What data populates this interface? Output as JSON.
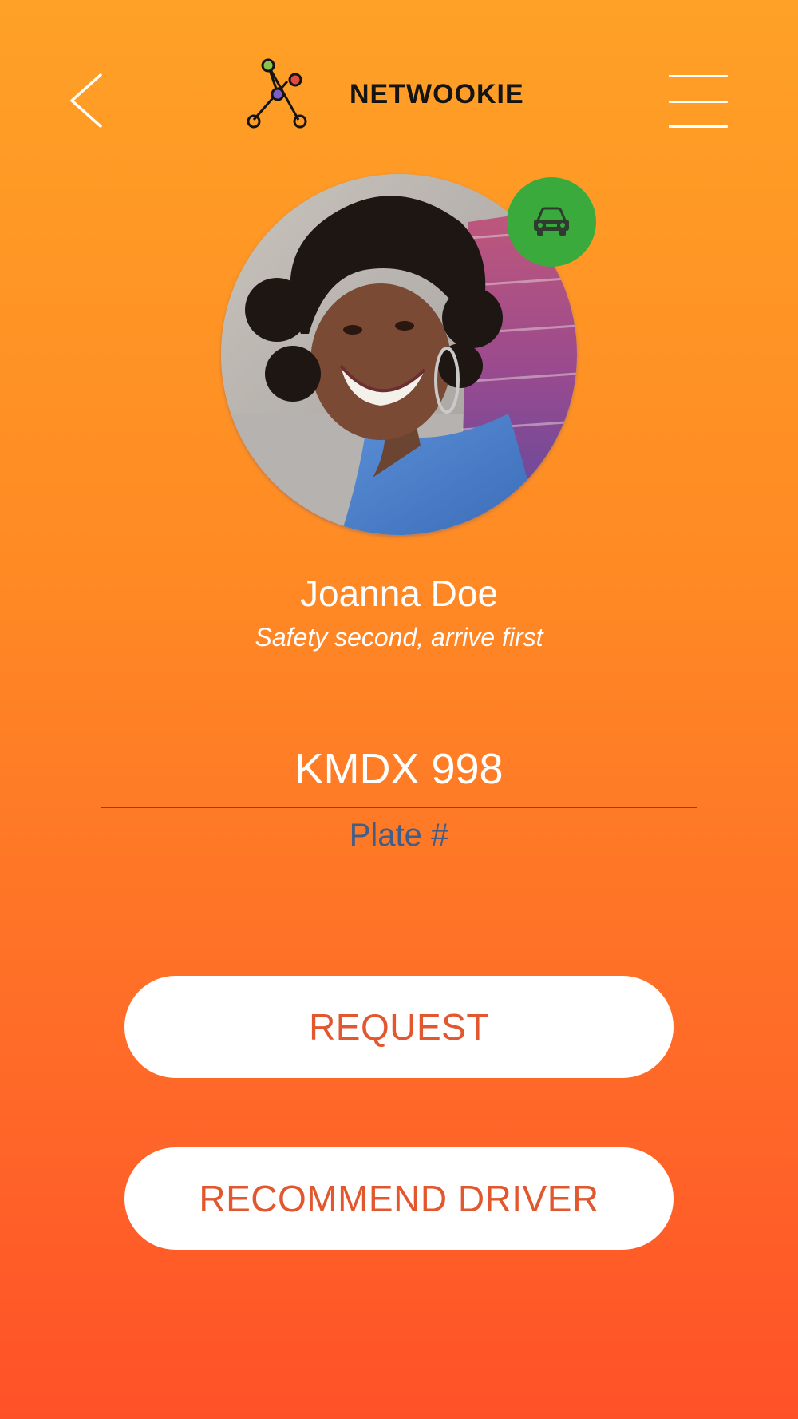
{
  "header": {
    "back_icon": "chevron-left-icon",
    "logo_icon": "network-nodes-icon",
    "brand_name": "NETWOOKIE",
    "menu_icon": "hamburger-menu-icon"
  },
  "profile": {
    "avatar": "profile-photo",
    "badge_icon": "car-icon",
    "name": "Joanna Doe",
    "tagline": "Safety second, arrive first"
  },
  "plate": {
    "value": "KMDX 998",
    "label": "Plate #"
  },
  "actions": {
    "request_label": "REQUEST",
    "recommend_label": "RECOMMEND DRIVER"
  },
  "colors": {
    "gradient_top": "#ffa126",
    "gradient_bottom": "#ff5128",
    "badge": "#3aaa3c",
    "button_text": "#e2572e",
    "plate_label": "#3f5f8a"
  }
}
